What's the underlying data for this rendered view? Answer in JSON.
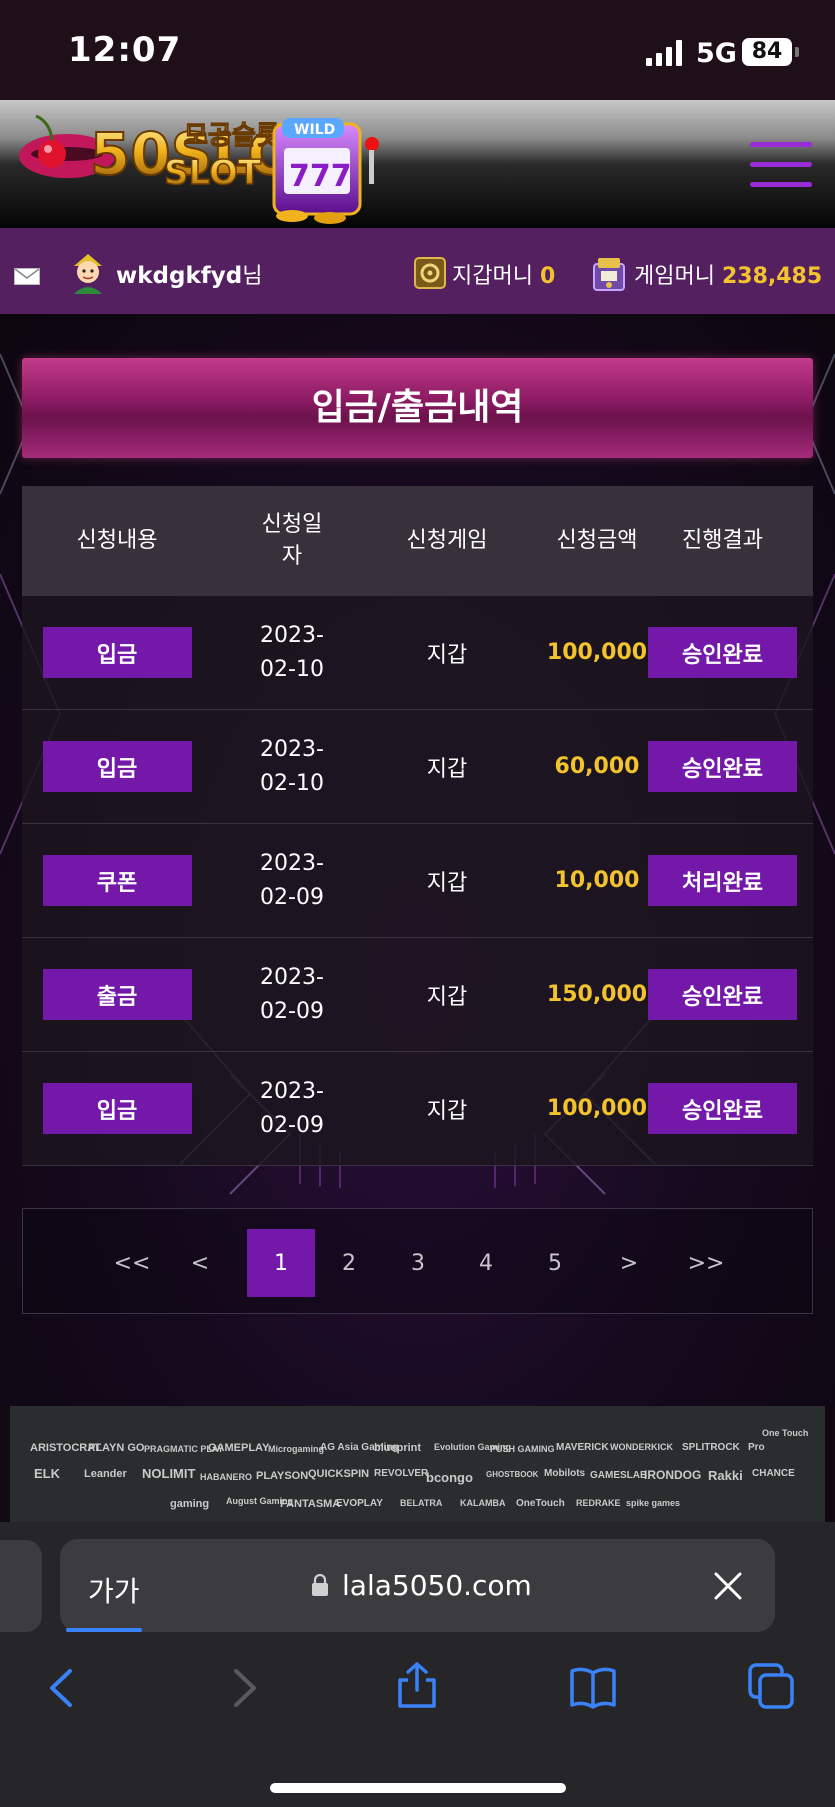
{
  "status_bar": {
    "time": "12:07",
    "network": "5G",
    "battery": "84"
  },
  "header": {
    "logo_text": "50SLOT",
    "logo_subtitle": "모공슬롯",
    "logo_badge": "WILD"
  },
  "user_bar": {
    "username": "wkdgkfyd",
    "honorific": "님",
    "wallet_label": "지갑머니",
    "wallet_value": "0",
    "game_label": "게임머니",
    "game_value": "238,485"
  },
  "page_title": "입금/출금내역",
  "table": {
    "headers": [
      "신청내용",
      "신청일\n자",
      "신청게임",
      "신청금액",
      "진행결과"
    ],
    "rows": [
      {
        "type": "입금",
        "date": "2023-\n02-10",
        "game": "지갑",
        "amount": "100,000",
        "result": "승인완료"
      },
      {
        "type": "입금",
        "date": "2023-\n02-10",
        "game": "지갑",
        "amount": "60,000",
        "result": "승인완료"
      },
      {
        "type": "쿠폰",
        "date": "2023-\n02-09",
        "game": "지갑",
        "amount": "10,000",
        "result": "처리완료"
      },
      {
        "type": "출금",
        "date": "2023-\n02-09",
        "game": "지갑",
        "amount": "150,000",
        "result": "승인완료"
      },
      {
        "type": "입금",
        "date": "2023-\n02-09",
        "game": "지갑",
        "amount": "100,000",
        "result": "승인완료"
      }
    ]
  },
  "pagination": {
    "first": "<<",
    "prev": "<",
    "pages": [
      "1",
      "2",
      "3",
      "4",
      "5"
    ],
    "current": "1",
    "next": ">",
    "last": ">>"
  },
  "providers": [
    "ARISTOCRAT",
    "PLAYN GO",
    "PRAGMATIC PLAY",
    "GAMEPLAY",
    "Microgaming",
    "AG Asia Gaming",
    "blueprint",
    "Evolution Gaming",
    "PUSH GAMING",
    "MAVERICK",
    "WONDERKICK",
    "SPLITROCK",
    "Pro",
    "One Touch",
    "ELK",
    "Leander",
    "NOLIMIT",
    "HABANERO",
    "PLAYSON",
    "QUICKSPIN",
    "REVOLVER",
    "bcongo",
    "GHOSTBOOK",
    "Mobilots",
    "GAMESLAB",
    "IRONDOG",
    "Rakki",
    "CHANCE",
    "gaming",
    "August Gaming",
    "FANTASMA",
    "EVOPLAY",
    "BELATRA",
    "KALAMBA",
    "OneTouch",
    "REDRAKE",
    "spike games"
  ],
  "browser": {
    "text_size": "가가",
    "url": "lala5050.com"
  },
  "colors": {
    "accent": "#7318a9",
    "gold": "#f3c32e",
    "banner": "#8e1c64",
    "userbar": "#55205f"
  }
}
